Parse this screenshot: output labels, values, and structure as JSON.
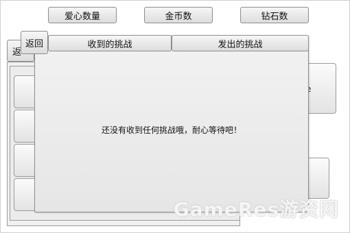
{
  "topbar": {
    "hearts_label": "爱心数量",
    "coins_label": "金币数",
    "diamonds_label": "钻石数"
  },
  "background_screen": {
    "back_label_partial": "返",
    "right_button_partial": "e"
  },
  "dialog": {
    "back_label": "返回",
    "tab_received": "收到的挑战",
    "tab_sent": "发出的挑战",
    "empty_message": "还没有收到任何挑战哦，耐心等待吧！"
  },
  "watermark": {
    "text": "GameRes游资网"
  }
}
